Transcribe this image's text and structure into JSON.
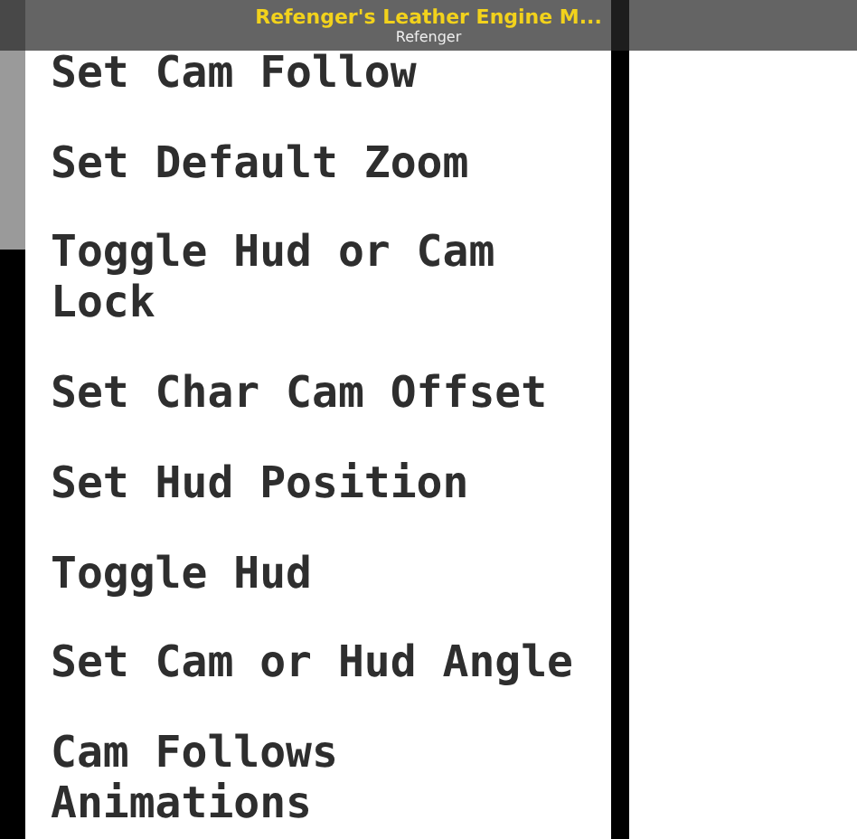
{
  "header": {
    "title": "Refenger's Leather Engine M...",
    "author": "Refenger"
  },
  "menu": {
    "items": [
      {
        "label": "Set Cam Follow"
      },
      {
        "label": "Set Default Zoom"
      },
      {
        "label": "Toggle Hud or Cam Lock"
      },
      {
        "label": "Set Char Cam Offset"
      },
      {
        "label": "Set Hud Position"
      },
      {
        "label": "Toggle Hud"
      },
      {
        "label": "Set Cam or Hud Angle"
      },
      {
        "label": "Cam Follows Animations"
      }
    ]
  }
}
